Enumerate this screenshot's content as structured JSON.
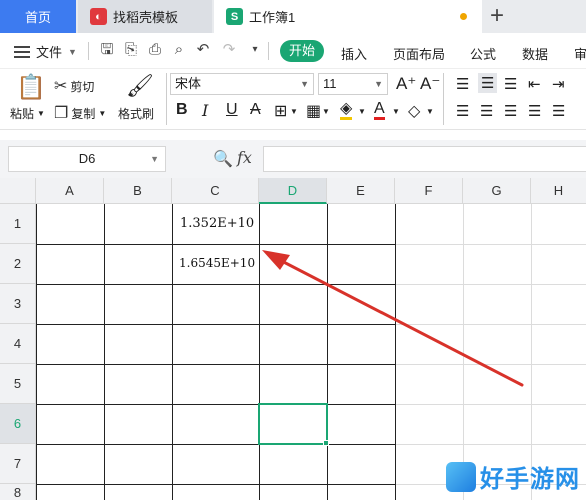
{
  "tabs": {
    "home": "首页",
    "docer": "找稻壳模板",
    "workbook": "工作簿1",
    "new_tab": "+"
  },
  "menu": {
    "file": "文件",
    "items": [
      "开始",
      "插入",
      "页面布局",
      "公式",
      "数据",
      "审"
    ]
  },
  "ribbon": {
    "paste": "粘贴",
    "cut": "剪切",
    "copy": "复制",
    "format_painter": "格式刷",
    "font_name": "宋体",
    "font_size": "11",
    "bold": "B",
    "italic": "I",
    "underline": "U",
    "strikethrough": "A",
    "font_color": "A",
    "grow_font": "A⁺",
    "shrink_font": "A⁻"
  },
  "formula_bar": {
    "cell_ref": "D6",
    "fx": "fx",
    "value": ""
  },
  "grid": {
    "columns": [
      "A",
      "B",
      "C",
      "D",
      "E",
      "F",
      "G",
      "H"
    ],
    "rows": [
      "1",
      "2",
      "3",
      "4",
      "5",
      "6",
      "7",
      "8"
    ],
    "active_column": "D",
    "active_row": "6",
    "cells": {
      "C1": "1.352E+10",
      "C2": "1.6545E+10"
    }
  },
  "watermark": "好手游网",
  "colors": {
    "accent": "#1aa673",
    "home_tab": "#3d7bf0",
    "arrow": "#d8322a"
  }
}
